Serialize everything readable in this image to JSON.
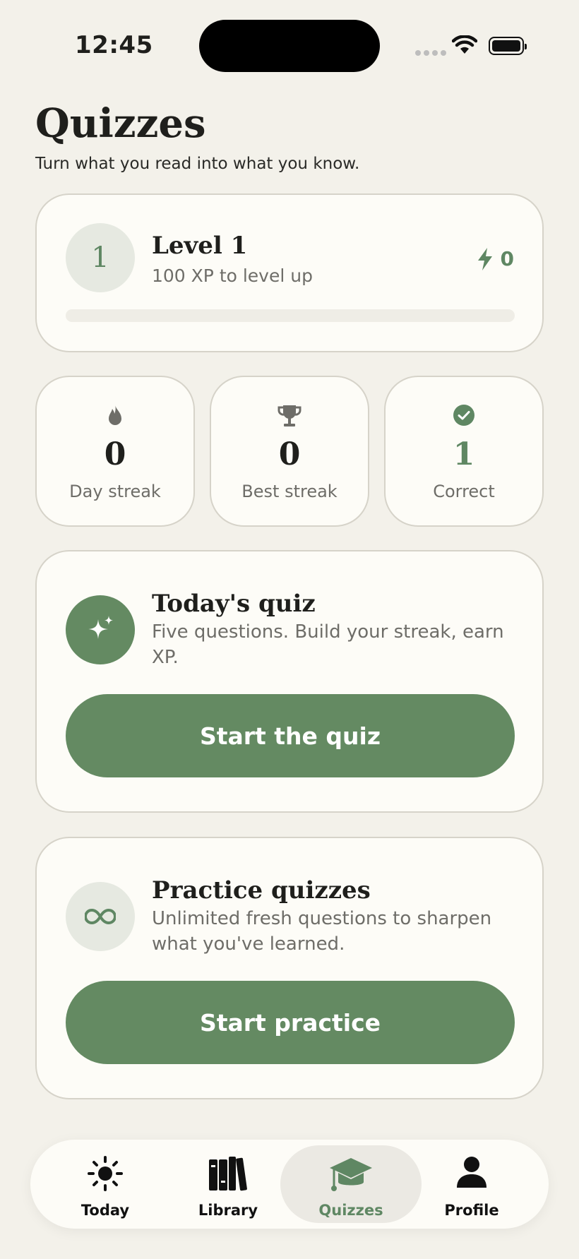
{
  "status_bar": {
    "time": "12:45"
  },
  "header": {
    "title": "Quizzes",
    "subtitle": "Turn what you read into what you know."
  },
  "level": {
    "badge": "1",
    "title": "Level 1",
    "subtitle": "100 XP to level up",
    "xp": "0",
    "progress_fraction": 0
  },
  "stats": [
    {
      "value": "0",
      "label": "Day streak",
      "icon": "flame-icon"
    },
    {
      "value": "0",
      "label": "Best streak",
      "icon": "trophy-icon"
    },
    {
      "value": "1",
      "label": "Correct",
      "icon": "check-circle-icon"
    }
  ],
  "daily_quiz": {
    "title": "Today's quiz",
    "description": "Five questions. Build your streak, earn XP.",
    "button": "Start the quiz",
    "icon": "sparkles-icon"
  },
  "practice": {
    "title": "Practice quizzes",
    "description": "Unlimited fresh questions to sharpen what you've learned.",
    "button": "Start practice",
    "icon": "infinity-icon"
  },
  "tabs": [
    {
      "label": "Today",
      "icon": "sun-icon"
    },
    {
      "label": "Library",
      "icon": "books-icon"
    },
    {
      "label": "Quizzes",
      "icon": "graduation-cap-icon",
      "active": true
    },
    {
      "label": "Profile",
      "icon": "person-icon"
    }
  ],
  "colors": {
    "background": "#f3f1ea",
    "card": "#fdfcf7",
    "accent": "#648a62",
    "muted_text": "#6e6d68"
  }
}
